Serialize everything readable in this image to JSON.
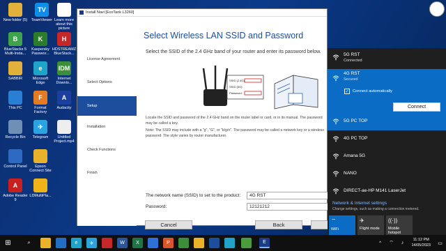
{
  "desktop_icons": [
    {
      "label": "New folder (5)",
      "color": "#e2b13c",
      "glyph": ""
    },
    {
      "label": "TeamViewer",
      "color": "#0e8ee9",
      "glyph": "TV"
    },
    {
      "label": "Learn more about this picture",
      "color": "#ffffff",
      "glyph": ""
    },
    {
      "label": "BlueStacks 5 Multi-Insta...",
      "color": "#3fa34d",
      "glyph": "B"
    },
    {
      "label": "Kaspersky Passwor...",
      "color": "#2b7d2b",
      "glyph": "K"
    },
    {
      "label": "HDSTREAMZ BlueStack...",
      "color": "#c62828",
      "glyph": "H"
    },
    {
      "label": "SABBIR",
      "color": "#e2b13c",
      "glyph": ""
    },
    {
      "label": "Microsoft Edge",
      "color": "#1fa3c9",
      "glyph": "e"
    },
    {
      "label": "Internet Downlo...",
      "color": "#3b8f3b",
      "glyph": "IDM"
    },
    {
      "label": "This PC",
      "color": "#2a7fd4",
      "glyph": ""
    },
    {
      "label": "Format Factory",
      "color": "#e57c23",
      "glyph": "F"
    },
    {
      "label": "Audacity",
      "color": "#1c3e9c",
      "glyph": "A"
    },
    {
      "label": "Recycle Bin",
      "color": "#6f8fb4",
      "glyph": ""
    },
    {
      "label": "Telegram",
      "color": "#2aa3df",
      "glyph": "✈"
    },
    {
      "label": "Untitled Project.mp4",
      "color": "#eeeeee",
      "glyph": ""
    },
    {
      "label": "Control Panel",
      "color": "#2d6bc2",
      "glyph": ""
    },
    {
      "label": "Epson Connect Site",
      "color": "#e8b22a",
      "glyph": ""
    },
    {
      "label": "Adobe Reader 9",
      "color": "#c8201f",
      "glyph": "A"
    },
    {
      "label": "LDMultiPla...",
      "color": "#f0b419",
      "glyph": ""
    }
  ],
  "window": {
    "title": "Install Navi [EcoTank L3260]",
    "steps": [
      "License Agreement",
      "Select Options",
      "Setup",
      "Installation",
      "Check Functions",
      "Finish"
    ],
    "heading": "Select Wireless LAN SSID and Password",
    "subtext": "Select the SSID of the 2.4 GHz band of your router and enter its password below.",
    "description": "Locate the SSID and password of the 2.4 GHz band on the router label or card, or in its manual. The password may be called a key.",
    "note": "Note: The SSID may include with a \"g\", \"G\", or \"b/g/n\". The password may be called a network key or a wireless password. The style varies by router manufacturer.",
    "ssid_label": "The network name (SSID) to set to the product:",
    "ssid_value": "4G RST",
    "password_label": "Password:",
    "password_value": "12121212",
    "cancel": "Cancel",
    "back": "Back",
    "router_label_lines": [
      "SSID (2.4G):",
      "SSID (5G):",
      "Password:"
    ]
  },
  "flyout": {
    "networks": [
      {
        "name": "5G RST",
        "status": "Connected"
      },
      {
        "name": "4G RST",
        "status": "Secured"
      },
      {
        "name": "5G PC TOP",
        "status": ""
      },
      {
        "name": "4G PC TOP",
        "status": ""
      },
      {
        "name": "Amana 5G",
        "status": ""
      },
      {
        "name": "NANO",
        "status": ""
      },
      {
        "name": "DIRECT-ae-HP M141 LaserJet",
        "status": ""
      }
    ],
    "connect_auto": "Connect automatically",
    "connect_button": "Connect",
    "settings_title": "Network & Internet settings",
    "settings_sub": "Change settings, such as making a connection metered.",
    "quick_actions": [
      {
        "label": "WiFi",
        "icon": "wifi-icon"
      },
      {
        "label": "Flight mode",
        "icon": "airplane-icon"
      },
      {
        "label": "Mobile hotspot",
        "icon": "hotspot-icon"
      }
    ]
  },
  "taskbar": {
    "time": "11:12 PM",
    "date": "14/05/2023"
  }
}
